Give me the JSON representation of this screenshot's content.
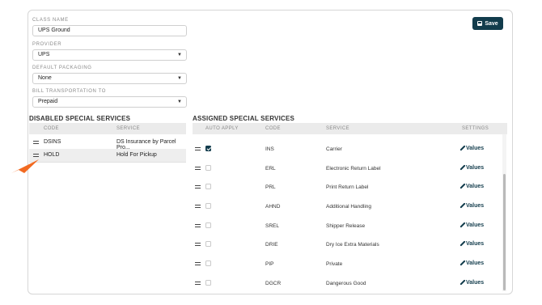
{
  "toolbar": {
    "save_label": "Save",
    "save_icon": "floppy-disk-icon"
  },
  "form": {
    "class_name": {
      "label": "CLASS NAME",
      "value": "UPS Ground"
    },
    "provider": {
      "label": "PROVIDER",
      "value": "UPS"
    },
    "default_packaging": {
      "label": "DEFAULT PACKAGING",
      "value": "None"
    },
    "bill_transportation": {
      "label": "BILL TRANSPORTATION TO",
      "value": "Prepaid"
    }
  },
  "disabled": {
    "title": "DISABLED SPECIAL SERVICES",
    "headers": {
      "code": "CODE",
      "service": "SERVICE"
    },
    "rows": [
      {
        "code": "DSINS",
        "service": "DS Insurance by Parcel Pro..."
      },
      {
        "code": "HOLD",
        "service": "Hold For Pickup"
      }
    ]
  },
  "assigned": {
    "title": "ASSIGNED SPECIAL SERVICES",
    "headers": {
      "auto_apply": "AUTO APPLY",
      "code": "CODE",
      "service": "SERVICE",
      "settings": "SETTINGS"
    },
    "values_label": "Values",
    "rows": [
      {
        "code": "INS",
        "service": "Carrier",
        "auto": true
      },
      {
        "code": "ERL",
        "service": "Electronic Return Label",
        "auto": false
      },
      {
        "code": "PRL",
        "service": "Print Return Label",
        "auto": false
      },
      {
        "code": "AHND",
        "service": "Additional Handling",
        "auto": false
      },
      {
        "code": "SREL",
        "service": "Shipper Release",
        "auto": false
      },
      {
        "code": "DRIE",
        "service": "Dry Ice Extra Materials",
        "auto": false
      },
      {
        "code": "PIP",
        "service": "Private",
        "auto": false
      },
      {
        "code": "DGCR",
        "service": "Dangerous Good",
        "auto": false
      }
    ]
  },
  "colors": {
    "accent": "#123c4c",
    "pointer": "#f26a21"
  }
}
